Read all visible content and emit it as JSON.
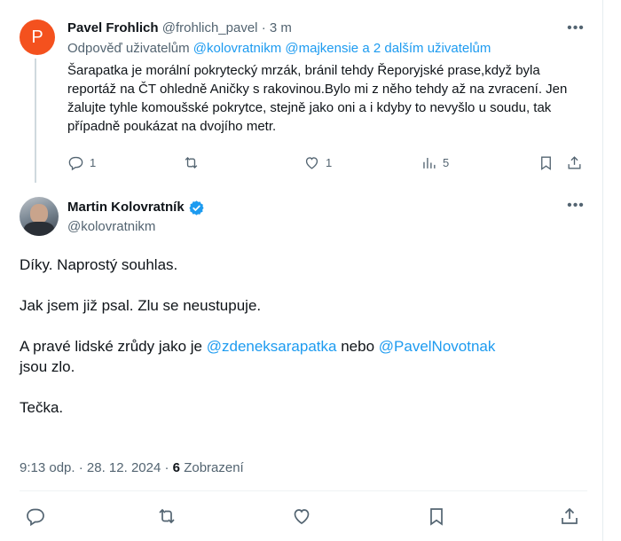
{
  "reply": {
    "avatar_letter": "P",
    "avatar_color": "#f4511e",
    "name": "Pavel Frohlich",
    "handle": "@frohlich_pavel",
    "separator": "·",
    "time": "3 m",
    "more_icon": "more-dots-icon",
    "replying_prefix": "Odpověď uživatelům",
    "replying_mention1": "@kolovratnikm",
    "replying_mention2": "@majkensie",
    "replying_others": "a 2 dalším uživatelům",
    "text": "Šarapatka je morální pokrytecký mrzák, bránil tehdy Řeporyjské prase,když byla reportáž na ČT ohledně Aničky s rakovinou.Bylo mi z něho tehdy až na zvracení. Jen žalujte tyhle komoušské pokrytce, stejně jako oni a i kdyby to nevyšlo u soudu, tak případně poukázat na dvojího metr.",
    "actions": {
      "reply_count": "1",
      "retweet_count": "",
      "like_count": "1",
      "views_count": "5"
    }
  },
  "tweet": {
    "name": "Martin Kolovratník",
    "handle": "@kolovratnikm",
    "verified_color": "#1d9bf0",
    "line1": "Díky.  Naprostý souhlas.",
    "line2": "Jak jsem již psal. Zlu se neustupuje.",
    "line3_prefix": "A pravé lidské zrůdy jako je",
    "line3_link1": "@zdeneksarapatka",
    "line3_mid": "nebo",
    "line3_link2": "@PavelNovotnak",
    "line3_suffix": "jsou zlo.",
    "line4": "Tečka.",
    "time": "9:13 odp.",
    "dot": "·",
    "date": "28. 12. 2024",
    "views_count": "6",
    "views_label": "Zobrazení"
  },
  "colors": {
    "accent": "#1d9bf0",
    "muted": "#536471",
    "text": "#0f1419"
  }
}
